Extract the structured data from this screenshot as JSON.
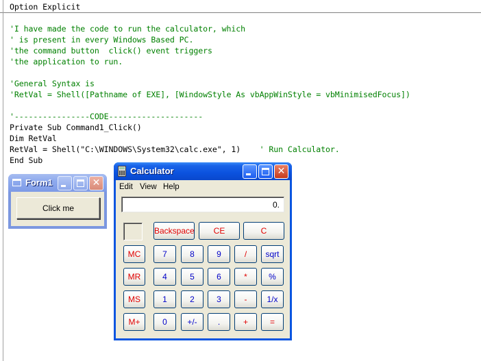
{
  "editor": {
    "header": "Option Explicit",
    "comments": [
      "'I have made the code to run the calculator, which",
      "' is present in every Windows Based PC.",
      "'the command button  click() event triggers",
      "'the application to run."
    ],
    "syntax": [
      "'General Syntax is",
      "'RetVal = Shell([Pathname of EXE], [WindowStyle As vbAppWinStyle = vbMinimisedFocus])"
    ],
    "separator": "'----------------CODE--------------------",
    "code": [
      "Private Sub Command1_Click()",
      "Dim RetVal",
      "RetVal = Shell(\"C:\\WINDOWS\\System32\\calc.exe\", 1)    ",
      "End Sub"
    ],
    "inline_comment": "' Run Calculator."
  },
  "form1": {
    "title": "Form1",
    "button_label": "Click me"
  },
  "calculator": {
    "title": "Calculator",
    "menu": [
      "Edit",
      "View",
      "Help"
    ],
    "display": "0.",
    "top_buttons": [
      "Backspace",
      "CE",
      "C"
    ],
    "memory_buttons": [
      "MC",
      "MR",
      "MS",
      "M+"
    ],
    "keypad": [
      [
        "7",
        "8",
        "9",
        "/",
        "sqrt"
      ],
      [
        "4",
        "5",
        "6",
        "*",
        "%"
      ],
      [
        "1",
        "2",
        "3",
        "-",
        "1/x"
      ],
      [
        "0",
        "+/-",
        ".",
        "+",
        "="
      ]
    ],
    "colors": {
      "red": "#e00000",
      "blue": "#0000c8"
    }
  },
  "title_buttons": {
    "minimize": "minimize-icon",
    "maximize": "maximize-icon",
    "close": "close-icon"
  }
}
